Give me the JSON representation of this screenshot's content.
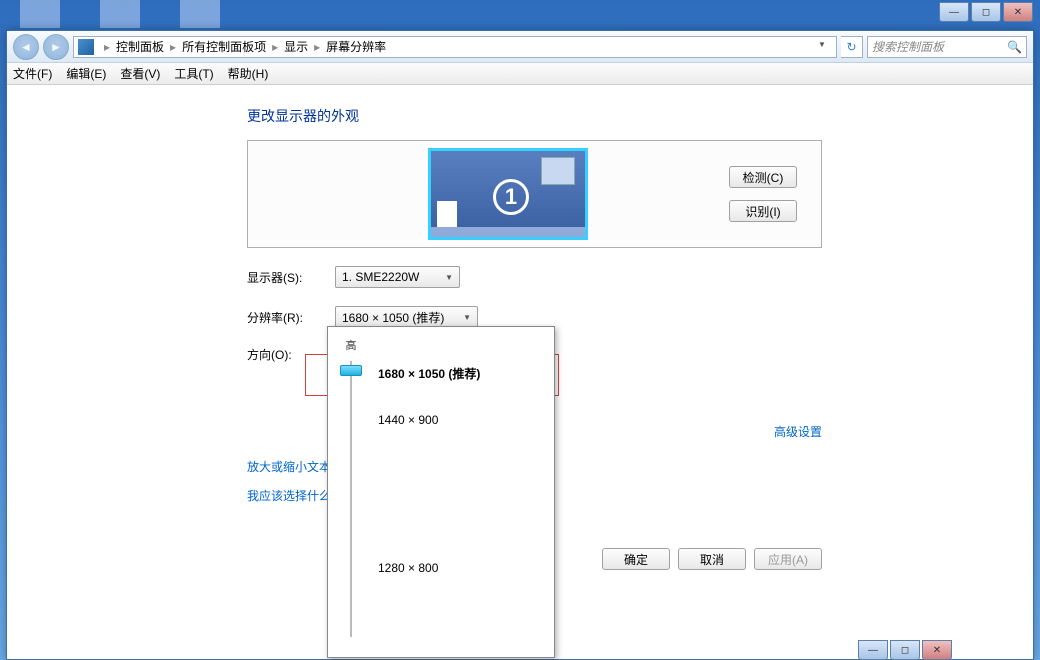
{
  "breadcrumb": {
    "items": [
      "控制面板",
      "所有控制面板项",
      "显示",
      "屏幕分辨率"
    ]
  },
  "search": {
    "placeholder": "搜索控制面板"
  },
  "menu": {
    "file": "文件(F)",
    "edit": "编辑(E)",
    "view": "查看(V)",
    "tools": "工具(T)",
    "help": "帮助(H)"
  },
  "heading": "更改显示器的外观",
  "monitor_number": "1",
  "buttons": {
    "detect": "检测(C)",
    "identify": "识别(I)",
    "ok": "确定",
    "cancel": "取消",
    "apply": "应用(A)"
  },
  "labels": {
    "display": "显示器(S):",
    "resolution": "分辨率(R):",
    "orientation": "方向(O):"
  },
  "values": {
    "display": "1. SME2220W",
    "resolution": "1680 × 1050 (推荐)"
  },
  "links": {
    "advanced": "高级设置",
    "textsize": "放大或缩小文本",
    "which": "我应该选择什么"
  },
  "slider": {
    "high": "高",
    "options": {
      "r1": "1680 × 1050 (推荐)",
      "r2": "1440 × 900",
      "r3": "1280 × 800"
    }
  }
}
